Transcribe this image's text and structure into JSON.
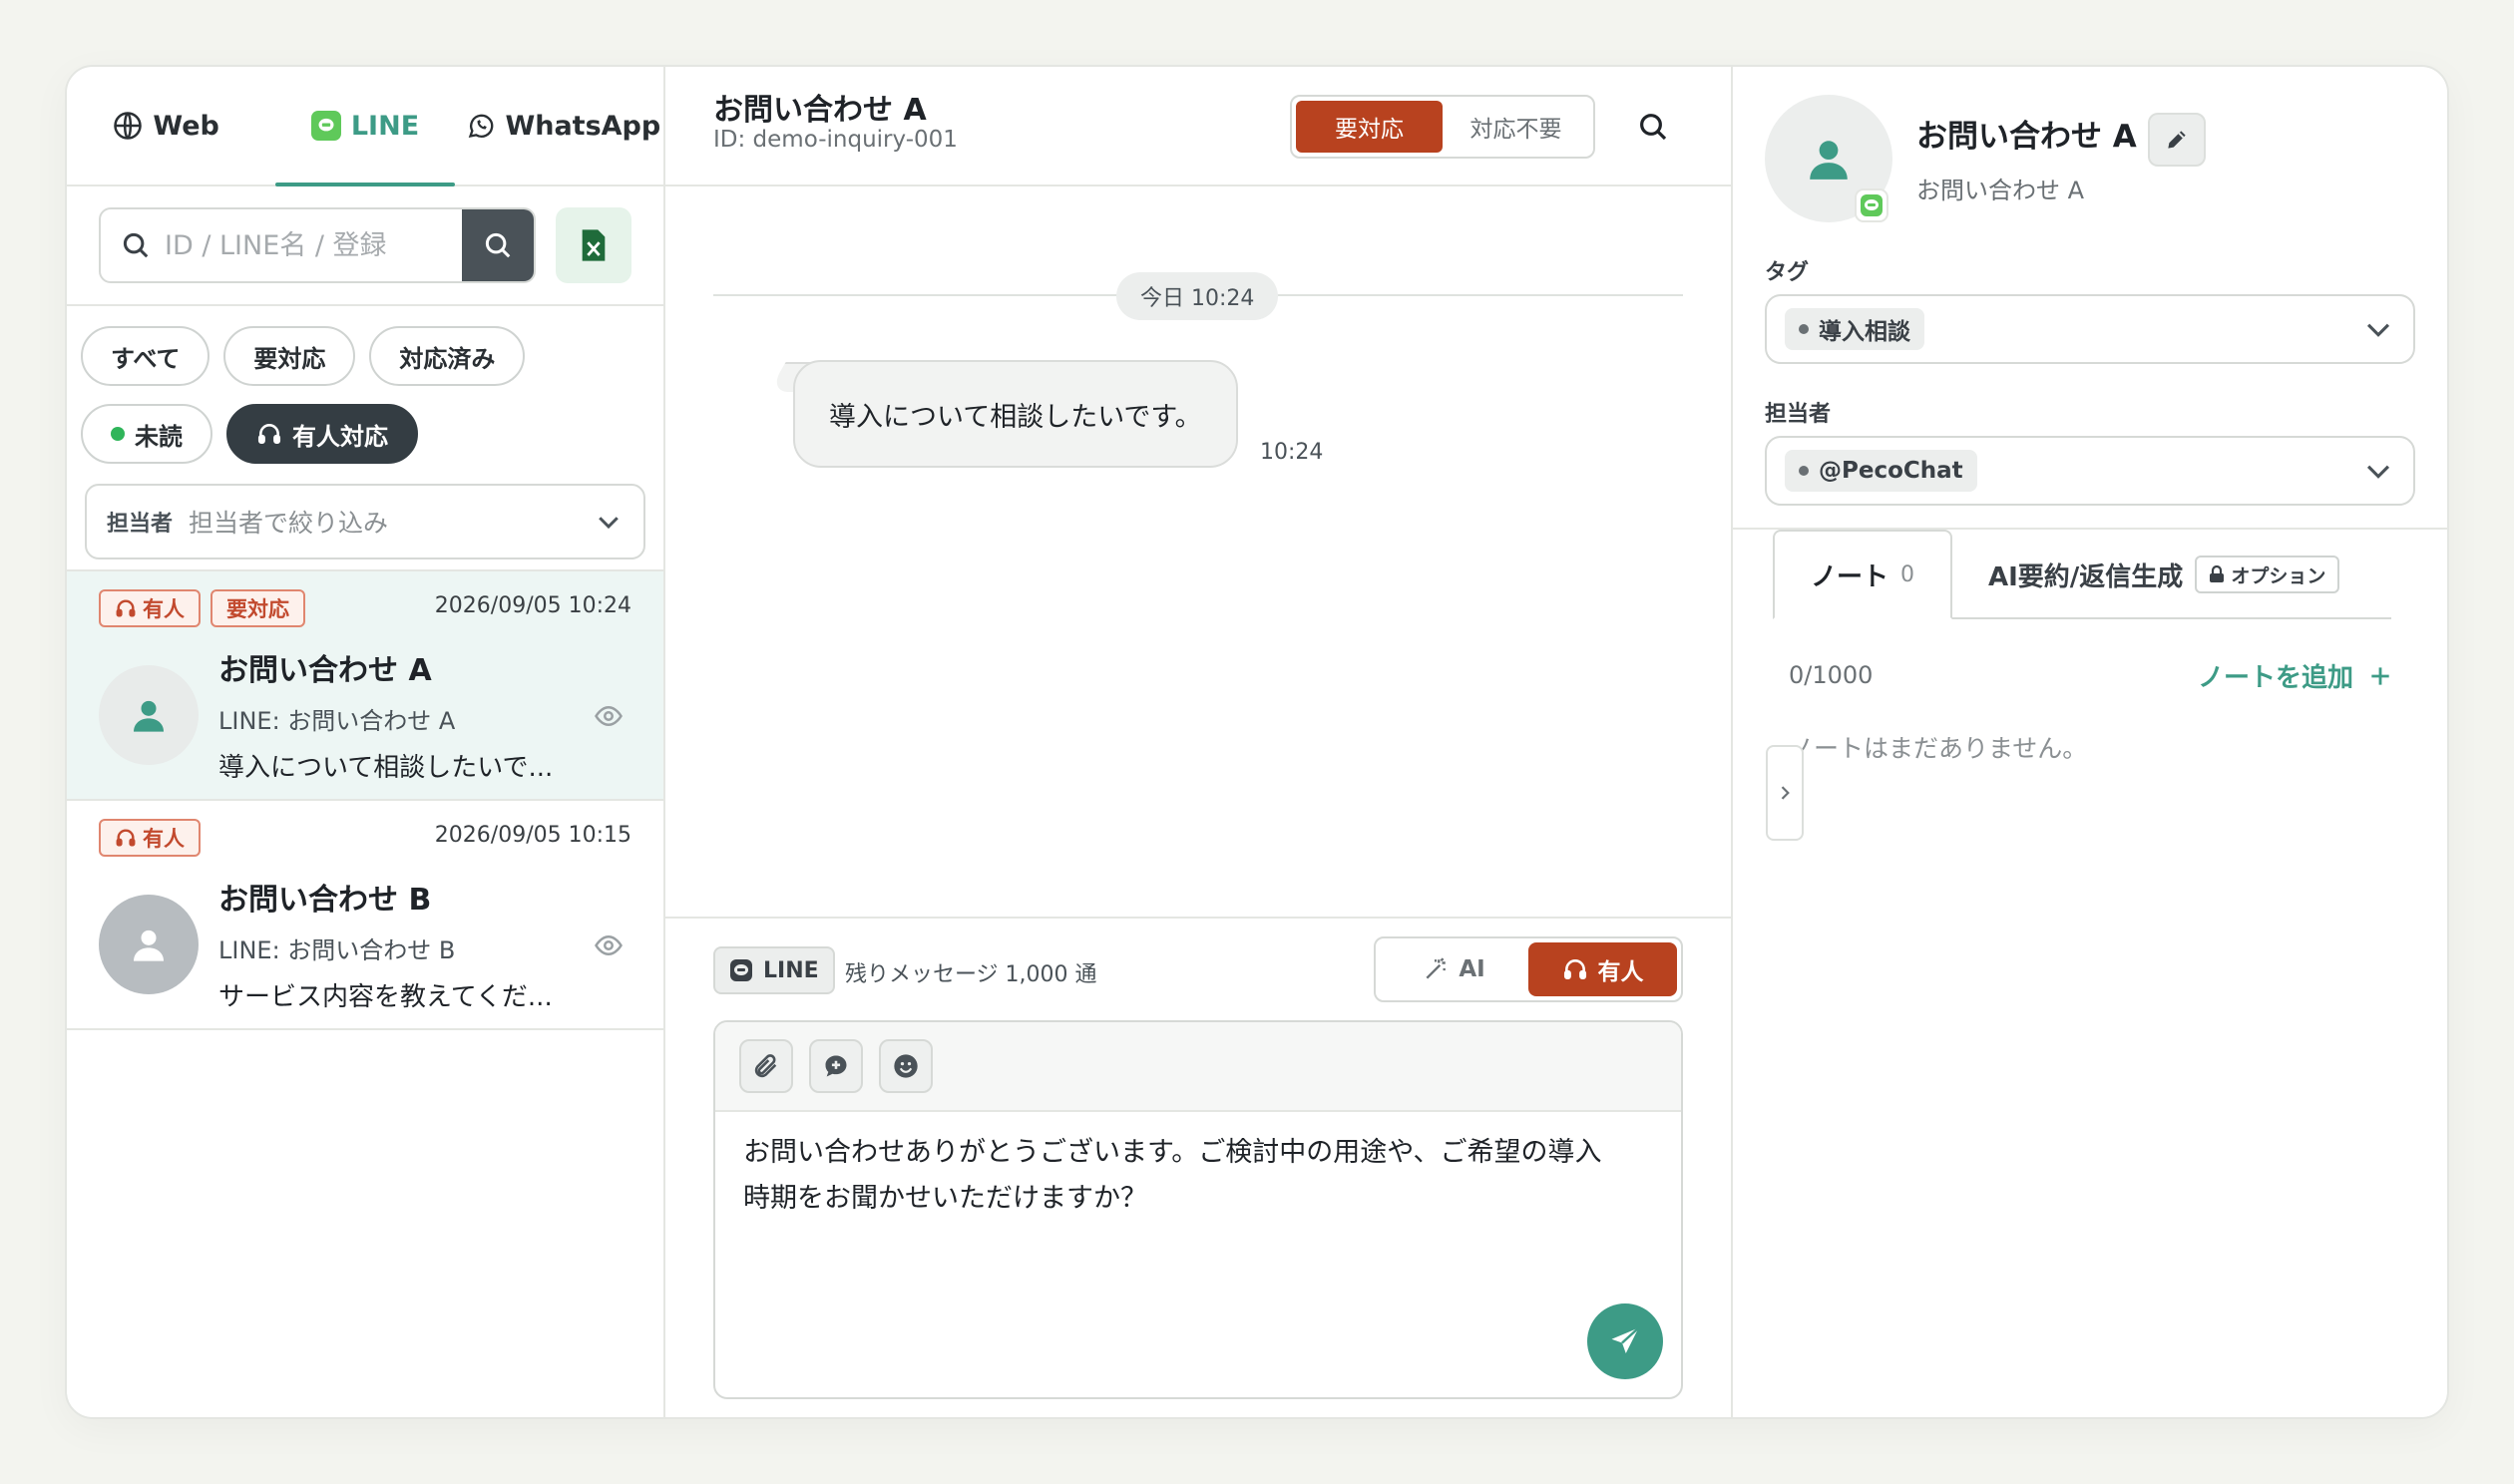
{
  "channels": [
    {
      "label": "Web",
      "icon": "globe-icon"
    },
    {
      "label": "LINE",
      "icon": "line-icon",
      "active": true
    },
    {
      "label": "WhatsApp",
      "icon": "whatsapp-icon"
    }
  ],
  "search": {
    "placeholder": "ID / LINE名 / 登録"
  },
  "filters": {
    "all": "すべて",
    "needs_action": "要対応",
    "done": "対応済み",
    "unread": "未読",
    "human": "有人対応"
  },
  "assignee_filter": {
    "label": "担当者",
    "placeholder": "担当者で絞り込み"
  },
  "conversations": [
    {
      "tags": [
        "有人",
        "要対応"
      ],
      "time": "2026/09/05 10:24",
      "name": "お問い合わせ A",
      "sub": "LINE: お問い合わせ A",
      "preview": "導入について相談したいで..."
    },
    {
      "tags": [
        "有人"
      ],
      "time": "2026/09/05 10:15",
      "name": "お問い合わせ B",
      "sub": "LINE: お問い合わせ B",
      "preview": "サービス内容を教えてくだ..."
    }
  ],
  "chat": {
    "title": "お問い合わせ A",
    "id": "ID: demo-inquiry-001",
    "status_on": "要対応",
    "status_off": "対応不要",
    "date_label": "今日 10:24",
    "messages": [
      {
        "text": "導入について相談したいです。",
        "time": "10:24"
      }
    ],
    "channel": "LINE",
    "remaining": "残りメッセージ 1,000 通",
    "mode_ai": "AI",
    "mode_human": "有人",
    "draft": "お問い合わせありがとうございます。ご検討中の用途や、ご希望の導入\n時期をお聞かせいただけますか？"
  },
  "profile": {
    "name": "お問い合わせ A",
    "sub": "お問い合わせ A",
    "tag_label": "タグ",
    "tag_value": "導入相談",
    "assignee_label": "担当者",
    "assignee_value": "@PecoChat"
  },
  "notes": {
    "tab_notes": "ノート",
    "tab_notes_count": "0",
    "tab_ai": "AI要約/返信生成",
    "option_badge": "オプション",
    "count": "0/1000",
    "add_label": "ノートを追加",
    "empty": "ノートはまだありません。"
  },
  "colors": {
    "accent": "#3d9b86",
    "danger": "#b8421f",
    "line_green": "#5fc95a"
  }
}
